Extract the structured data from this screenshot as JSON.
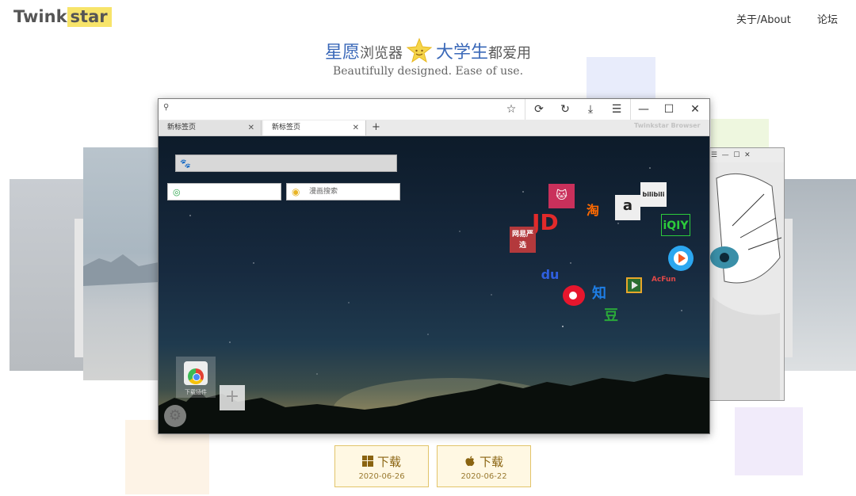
{
  "header": {
    "logo_part1": "Twink",
    "logo_part2": "star",
    "nav": [
      "关于/About",
      "论坛"
    ]
  },
  "hero": {
    "headline_1": "星愿",
    "headline_2": "浏览器",
    "headline_3": "大学生",
    "headline_4": "都爱用",
    "tagline": "Beautifully designed. Ease of use."
  },
  "browser": {
    "tabs": [
      "新标签页",
      "新标签页"
    ],
    "brand": "Twinkstar Browser",
    "search_placeholder": "漫画搜索",
    "app_label": "下载插件",
    "site_icons": [
      "JD",
      "网易严选",
      "淘",
      "a",
      "bilibili",
      "iQIY",
      "du",
      "知",
      "豆",
      "AcFun"
    ]
  },
  "downloads": [
    {
      "label": "下载",
      "date": "2020-06-26",
      "platform": "windows-icon"
    },
    {
      "label": "下载",
      "date": "2020-06-22",
      "platform": "apple-icon"
    }
  ],
  "colors": {
    "accent": "#3a68b8",
    "download_border": "#e2c46a",
    "logo_highlight": "#f7e46a"
  }
}
